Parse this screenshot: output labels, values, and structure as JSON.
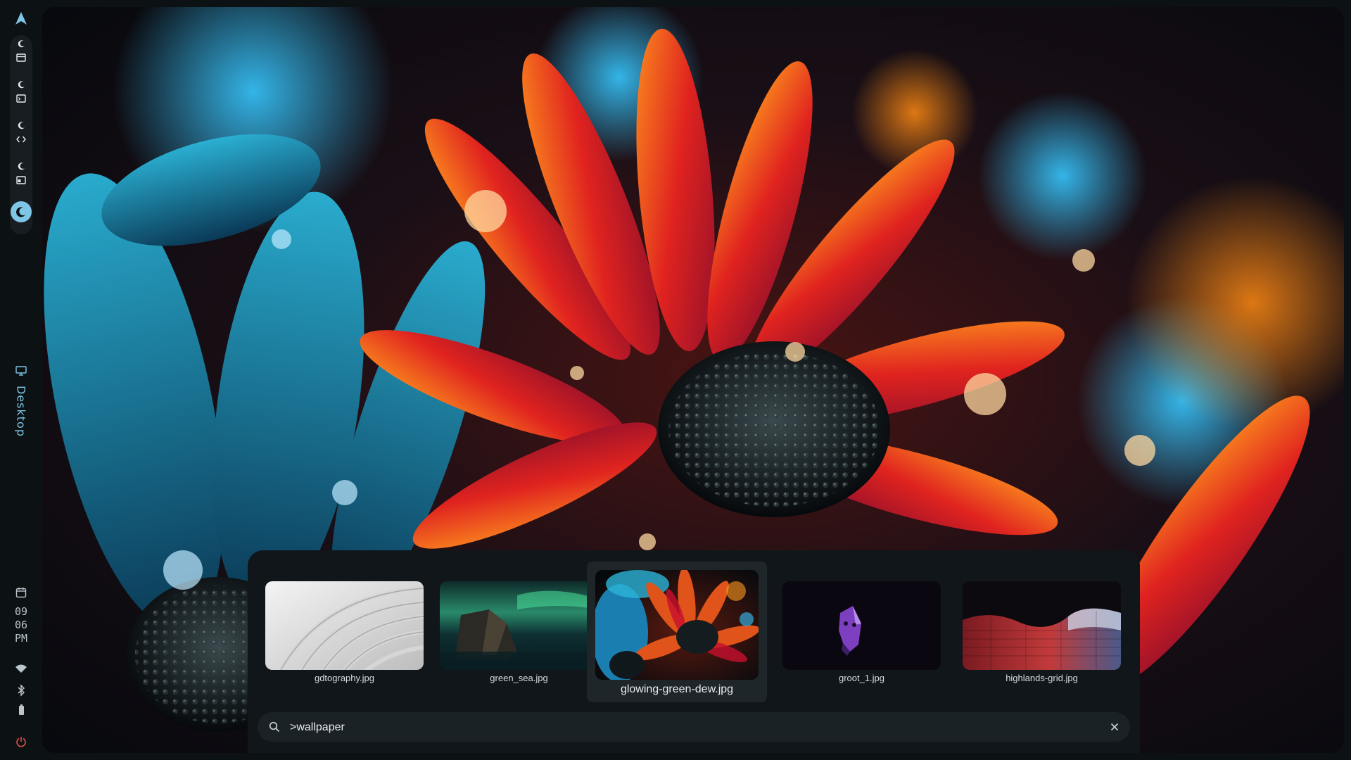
{
  "sidebar": {
    "logo": "arch-logo-icon",
    "workspaces": [
      {
        "name": "workspace-1",
        "app_icon": "window-icon"
      },
      {
        "name": "workspace-2",
        "app_icon": "terminal-icon"
      },
      {
        "name": "workspace-3",
        "app_icon": "code-icon"
      },
      {
        "name": "workspace-4",
        "app_icon": "file-manager-icon"
      },
      {
        "name": "workspace-5",
        "app_icon": "moon-icon",
        "active": true
      }
    ],
    "desktop_label": "Desktop",
    "clock": {
      "hour": "09",
      "minute": "06",
      "ampm": "PM"
    },
    "status_icons": [
      "calendar-icon",
      "wifi-icon",
      "bluetooth-icon",
      "battery-icon",
      "power-icon"
    ],
    "colors": {
      "background": "#0c1114",
      "accent": "#7fc6e6",
      "pill": "#171d21"
    }
  },
  "launcher": {
    "thumbnails": [
      {
        "filename": "gdtography.jpg",
        "selected": false
      },
      {
        "filename": "green_sea.jpg",
        "selected": false
      },
      {
        "filename": "glowing-green-dew.jpg",
        "selected": true
      },
      {
        "filename": "groot_1.jpg",
        "selected": false
      },
      {
        "filename": "highlands-grid.jpg",
        "selected": false
      }
    ],
    "search": {
      "value": ">wallpaper",
      "icon": "search-icon",
      "clear_icon": "close-icon"
    },
    "colors": {
      "panel": "#101619",
      "search_bg": "#1b2226",
      "selected_bg": "#1f262a"
    }
  }
}
